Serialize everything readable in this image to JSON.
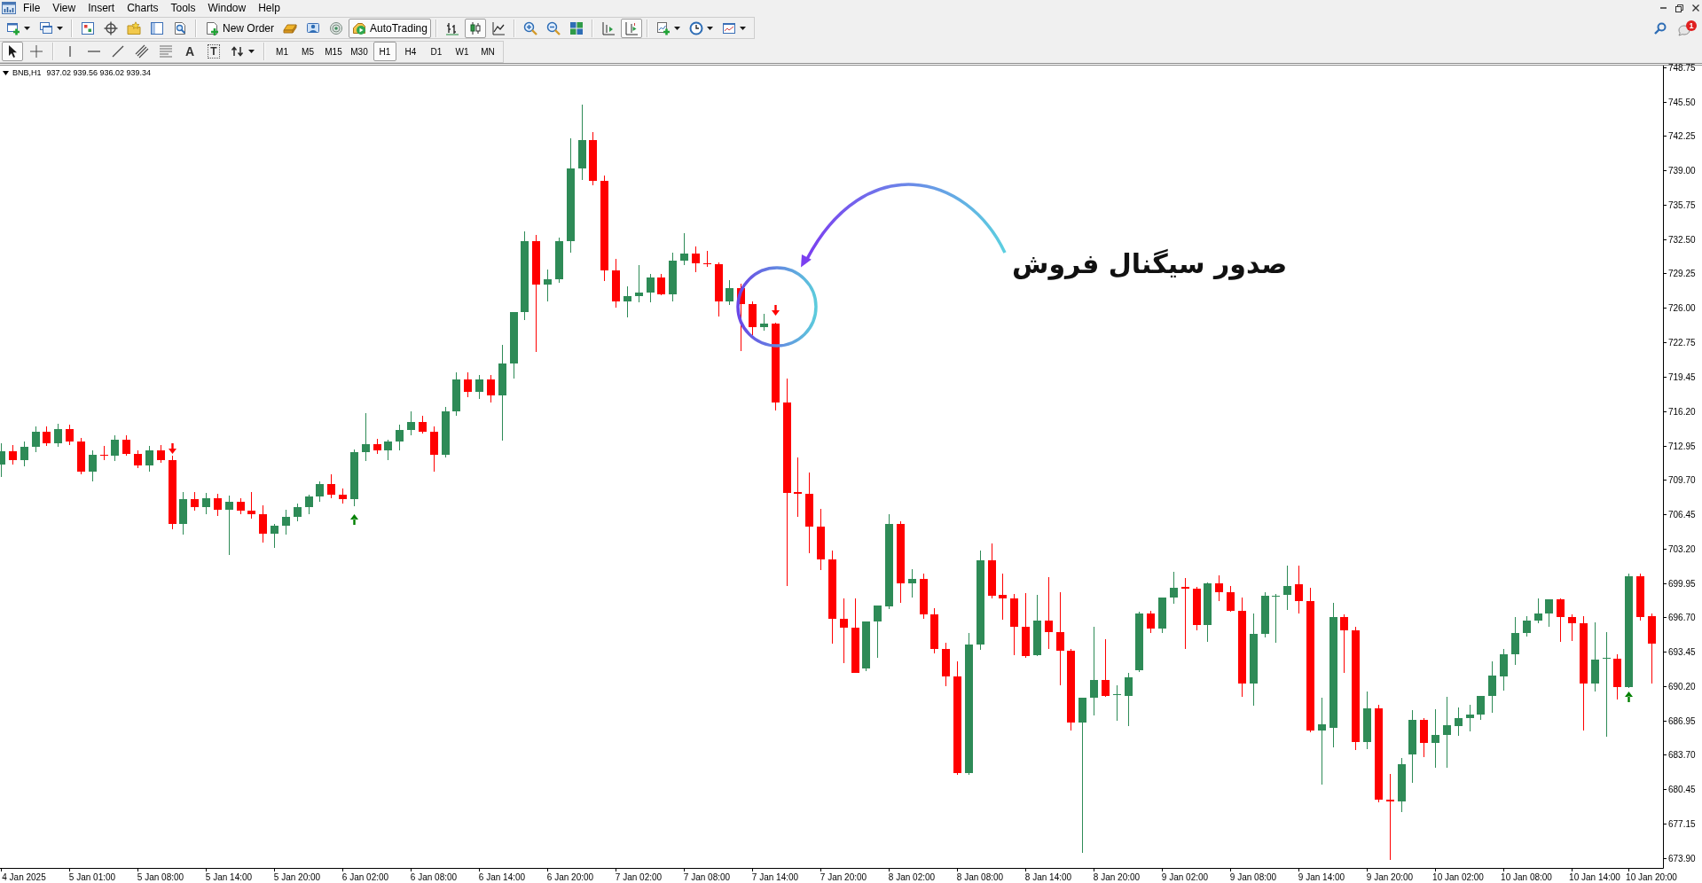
{
  "menu": [
    "File",
    "View",
    "Insert",
    "Charts",
    "Tools",
    "Window",
    "Help"
  ],
  "toolbar": [
    [
      {
        "kind": "icon_menu",
        "pressed": false
      },
      {
        "kind": "icon_menu",
        "pressed": false
      }
    ],
    [
      {
        "kind": "icon",
        "pressed": false
      },
      {
        "kind": "icon",
        "pressed": false
      },
      {
        "kind": "icon",
        "pressed": false
      },
      {
        "kind": "icon",
        "pressed": false
      },
      {
        "kind": "icon",
        "pressed": false
      }
    ],
    [
      {
        "kind": "button",
        "label": "New Order",
        "pressed": false
      },
      {
        "kind": "icon",
        "pressed": false
      },
      {
        "kind": "icon",
        "pressed": false
      },
      {
        "kind": "icon",
        "pressed": false
      },
      {
        "kind": "button",
        "label": "AutoTrading",
        "pressed": true
      }
    ],
    [
      {
        "kind": "icon",
        "pressed": false
      },
      {
        "kind": "icon",
        "pressed": true
      },
      {
        "kind": "icon",
        "pressed": false
      }
    ],
    [
      {
        "kind": "icon",
        "pressed": false
      },
      {
        "kind": "icon",
        "pressed": false
      },
      {
        "kind": "icon",
        "pressed": false
      }
    ],
    [
      {
        "kind": "icon",
        "pressed": false
      },
      {
        "kind": "icon",
        "pressed": true
      }
    ],
    [
      {
        "kind": "icon_menu",
        "pressed": false
      },
      {
        "kind": "icon_menu",
        "pressed": false
      },
      {
        "kind": "icon_menu",
        "pressed": false
      }
    ]
  ],
  "notifications": {
    "count": "1"
  },
  "drawing_toolbar": [
    [
      {
        "kind": "icon",
        "pressed": true
      },
      {
        "kind": "icon",
        "pressed": false
      }
    ],
    [
      {
        "kind": "icon",
        "pressed": false
      },
      {
        "kind": "icon",
        "pressed": false
      },
      {
        "kind": "icon",
        "pressed": false
      },
      {
        "kind": "icon",
        "pressed": false
      },
      {
        "kind": "icon",
        "pressed": false
      },
      {
        "kind": "glyph",
        "text": "A",
        "pressed": false
      },
      {
        "kind": "boxed_glyph",
        "text": "T",
        "pressed": false
      },
      {
        "kind": "icon_menu",
        "pressed": false
      }
    ]
  ],
  "timeframes": [
    {
      "label": "M1",
      "selected": false
    },
    {
      "label": "M5",
      "selected": false
    },
    {
      "label": "M15",
      "selected": false
    },
    {
      "label": "M30",
      "selected": false
    },
    {
      "label": "H1",
      "selected": true
    },
    {
      "label": "H4",
      "selected": false
    },
    {
      "label": "D1",
      "selected": false
    },
    {
      "label": "W1",
      "selected": false
    },
    {
      "label": "MN",
      "selected": false
    }
  ],
  "chart": {
    "symbol": "BNB,H1",
    "quote": "937.02 939.56 936.02 939.34",
    "chart_data": [
      {
        "type": "candlestick",
        "ylim": [
          672.98,
          748.92
        ],
        "yticks": [
          748.75,
          {
            "value": 745.5,
            "label": "745.50"
          },
          742.25,
          {
            "value": 739,
            "label": "739.00"
          },
          735.75,
          {
            "value": 732.5,
            "label": "732.50"
          },
          729.25,
          {
            "value": 726,
            "label": "726.00"
          },
          722.75,
          719.45,
          {
            "value": 716.2,
            "label": "716.20"
          },
          712.95,
          {
            "value": 709.7,
            "label": "709.70"
          },
          706.45,
          {
            "value": 703.2,
            "label": "703.20"
          },
          699.95,
          {
            "value": 696.7,
            "label": "696.70"
          },
          693.45,
          {
            "value": 690.2,
            "label": "690.20"
          },
          686.95,
          {
            "value": 683.7,
            "label": "683.70"
          },
          680.45,
          677.15,
          {
            "value": 673.9,
            "label": "673.90"
          }
        ],
        "categories": [
          null,
          null,
          "4 Jan 2025",
          null,
          null,
          null,
          null,
          null,
          "5 Jan 01:00",
          null,
          null,
          null,
          null,
          null,
          "5 Jan 08:00",
          null,
          null,
          null,
          null,
          null,
          "5 Jan 14:00",
          null,
          null,
          null,
          null,
          null,
          "5 Jan 20:00",
          null,
          null,
          null,
          null,
          null,
          "6 Jan 02:00",
          null,
          null,
          null,
          null,
          null,
          "6 Jan 08:00",
          null,
          null,
          null,
          null,
          null,
          "6 Jan 14:00",
          null,
          null,
          null,
          null,
          null,
          "6 Jan 20:00",
          null,
          null,
          null,
          null,
          null,
          "7 Jan 02:00",
          null,
          null,
          null,
          null,
          null,
          "7 Jan 08:00",
          null,
          null,
          null,
          null,
          null,
          "7 Jan 14:00",
          null,
          null,
          null,
          null,
          null,
          "7 Jan 20:00",
          null,
          null,
          null,
          null,
          null,
          "8 Jan 02:00",
          null,
          null,
          null,
          null,
          null,
          "8 Jan 08:00",
          null,
          null,
          null,
          null,
          null,
          "8 Jan 14:00",
          null,
          null,
          null,
          null,
          null,
          "8 Jan 20:00",
          null,
          null,
          null,
          null,
          null,
          "9 Jan 02:00",
          null,
          null,
          null,
          null,
          null,
          "9 Jan 08:00",
          null,
          null,
          null,
          null,
          null,
          "9 Jan 14:00",
          null,
          null,
          null,
          null,
          null,
          "9 Jan 20:00",
          null,
          null,
          null,
          null,
          null,
          "10 Jan 02:00",
          null,
          null,
          null,
          null,
          null,
          "10 Jan 08:00",
          null,
          null,
          null,
          null,
          null,
          "10 Jan 14:00",
          null,
          null,
          null,
          null,
          "10 Jan 20:00"
        ],
        "ohlc": [
          [
            711.2,
            713.2,
            710.0,
            712.4
          ],
          [
            712.4,
            713.0,
            711.2,
            711.6
          ],
          [
            711.6,
            713.3,
            711.0,
            712.8
          ],
          [
            712.8,
            714.8,
            712.3,
            714.3
          ],
          [
            714.3,
            714.8,
            712.9,
            713.2
          ],
          [
            713.2,
            715.0,
            712.8,
            714.5
          ],
          [
            714.5,
            714.9,
            713.0,
            713.3
          ],
          [
            713.3,
            713.7,
            710.2,
            710.5
          ],
          [
            710.5,
            712.5,
            709.6,
            712.1
          ],
          [
            712.1,
            712.9,
            711.6,
            712.0
          ],
          [
            712.0,
            713.9,
            711.5,
            713.5
          ],
          [
            713.5,
            713.9,
            712.0,
            712.2
          ],
          [
            712.2,
            712.5,
            710.8,
            711.1
          ],
          [
            711.1,
            712.9,
            710.5,
            712.5
          ],
          [
            712.5,
            713.0,
            711.3,
            711.6
          ],
          [
            711.6,
            712.0,
            705.0,
            705.5
          ],
          [
            705.5,
            708.6,
            704.5,
            707.9
          ],
          [
            707.9,
            708.6,
            706.8,
            707.1
          ],
          [
            707.1,
            708.5,
            706.5,
            708.0
          ],
          [
            708.0,
            708.4,
            706.3,
            706.9
          ],
          [
            706.9,
            708.2,
            702.6,
            707.6
          ],
          [
            707.6,
            708.0,
            706.5,
            706.8
          ],
          [
            706.8,
            708.6,
            706.0,
            706.5
          ],
          [
            706.5,
            707.3,
            703.8,
            704.6
          ],
          [
            704.6,
            705.5,
            703.3,
            705.4
          ],
          [
            705.4,
            706.9,
            704.5,
            706.2
          ],
          [
            706.2,
            707.5,
            705.8,
            707.1
          ],
          [
            707.1,
            708.3,
            706.5,
            708.1
          ],
          [
            708.1,
            709.6,
            707.6,
            709.3
          ],
          [
            709.3,
            710.2,
            708.0,
            708.3
          ],
          [
            708.3,
            708.9,
            707.5,
            707.9
          ],
          [
            707.9,
            712.6,
            707.2,
            712.3
          ],
          [
            712.3,
            716.0,
            711.5,
            713.1
          ],
          [
            713.1,
            713.6,
            712.2,
            712.5
          ],
          [
            712.5,
            713.5,
            711.6,
            713.3
          ],
          [
            713.3,
            714.9,
            712.5,
            714.4
          ],
          [
            714.4,
            716.2,
            713.9,
            715.2
          ],
          [
            715.2,
            715.8,
            714.1,
            714.3
          ],
          [
            714.3,
            714.8,
            710.5,
            712.1
          ],
          [
            712.1,
            716.6,
            711.8,
            716.2
          ],
          [
            716.2,
            719.9,
            715.8,
            719.2
          ],
          [
            719.2,
            719.9,
            717.5,
            718.0
          ],
          [
            718.0,
            719.6,
            717.4,
            719.2
          ],
          [
            719.2,
            719.6,
            717.0,
            717.7
          ],
          [
            717.7,
            722.5,
            713.4,
            720.7
          ],
          [
            720.7,
            725.6,
            719.3,
            725.6
          ],
          [
            725.6,
            733.2,
            724.8,
            732.3
          ],
          [
            732.3,
            732.9,
            721.8,
            728.2
          ],
          [
            728.2,
            729.6,
            726.6,
            728.7
          ],
          [
            728.7,
            732.6,
            728.4,
            732.3
          ],
          [
            732.3,
            742.0,
            731.2,
            739.2
          ],
          [
            739.2,
            745.2,
            738.1,
            741.9
          ],
          [
            741.9,
            742.6,
            737.6,
            738.0
          ],
          [
            738.0,
            738.5,
            728.5,
            729.5
          ],
          [
            729.5,
            730.6,
            726.0,
            726.6
          ],
          [
            726.6,
            728.0,
            725.1,
            727.1
          ],
          [
            727.1,
            730.0,
            726.5,
            727.4
          ],
          [
            727.4,
            729.2,
            726.5,
            728.9
          ],
          [
            728.9,
            729.2,
            727.2,
            727.3
          ],
          [
            727.3,
            731.2,
            726.6,
            730.45
          ],
          [
            730.45,
            733.1,
            730.0,
            731.1
          ],
          [
            731.1,
            731.8,
            729.4,
            730.2
          ],
          [
            730.2,
            731.4,
            729.9,
            730.1
          ],
          [
            730.1,
            730.3,
            725.2,
            726.6
          ],
          [
            726.6,
            728.6,
            726.3,
            727.9
          ],
          [
            727.9,
            728.3,
            721.9,
            726.35
          ],
          [
            726.35,
            726.6,
            723.4,
            724.2
          ],
          [
            724.2,
            725.4,
            723.8,
            724.5
          ],
          [
            724.5,
            724.6,
            716.3,
            717.0
          ],
          [
            717.0,
            719.3,
            699.7,
            708.5
          ],
          [
            708.6,
            711.8,
            706.2,
            708.4
          ],
          [
            708.4,
            710.4,
            702.8,
            705.3
          ],
          [
            705.3,
            707.0,
            701.2,
            702.2
          ],
          [
            702.2,
            703.0,
            694.2,
            696.6
          ],
          [
            696.6,
            698.5,
            692.4,
            695.75
          ],
          [
            695.75,
            698.5,
            691.4,
            691.4
          ],
          [
            691.9,
            696.3,
            691.6,
            696.3
          ],
          [
            696.3,
            697.8,
            692.9,
            697.8
          ],
          [
            697.7,
            706.5,
            697.5,
            705.5
          ],
          [
            705.5,
            705.8,
            698.1,
            699.9
          ],
          [
            699.9,
            701.3,
            698.6,
            700.3
          ],
          [
            700.3,
            700.8,
            696.6,
            697.0
          ],
          [
            697.0,
            697.6,
            693.3,
            693.7
          ],
          [
            693.7,
            694.3,
            690.2,
            691.07
          ],
          [
            691.07,
            692.5,
            681.8,
            682.0
          ],
          [
            682.0,
            695.2,
            681.8,
            694.1
          ],
          [
            694.1,
            703.0,
            693.6,
            702.1
          ],
          [
            702.1,
            703.7,
            698.5,
            698.7
          ],
          [
            698.8,
            700.8,
            696.5,
            698.5
          ],
          [
            698.5,
            698.9,
            693.1,
            695.8
          ],
          [
            695.8,
            699.0,
            692.9,
            693.0
          ],
          [
            693.1,
            698.8,
            693.0,
            696.4
          ],
          [
            696.4,
            700.5,
            693.7,
            695.3
          ],
          [
            695.3,
            699.1,
            690.3,
            693.5
          ],
          [
            693.5,
            693.7,
            686.0,
            686.7
          ],
          [
            686.7,
            689.1,
            674.4,
            689.1
          ],
          [
            689.1,
            695.8,
            687.4,
            690.8
          ],
          [
            690.8,
            694.6,
            689.2,
            689.3
          ],
          [
            689.4,
            690.3,
            686.9,
            689.4
          ],
          [
            689.3,
            691.4,
            686.4,
            691.0
          ],
          [
            691.7,
            697.2,
            691.5,
            697.1
          ],
          [
            697.1,
            697.3,
            695.2,
            695.6
          ],
          [
            695.6,
            698.6,
            695.2,
            698.6
          ],
          [
            698.6,
            701.0,
            698.0,
            699.5
          ],
          [
            699.6,
            700.4,
            693.7,
            699.4
          ],
          [
            699.4,
            699.6,
            695.5,
            696.0
          ],
          [
            696.0,
            700.0,
            694.4,
            699.9
          ],
          [
            699.9,
            700.7,
            698.2,
            699.1
          ],
          [
            699.1,
            699.7,
            697.2,
            697.3
          ],
          [
            697.3,
            698.6,
            689.2,
            690.4
          ],
          [
            690.4,
            697.1,
            688.3,
            695.1
          ],
          [
            695.1,
            699.1,
            694.8,
            698.7
          ],
          [
            698.7,
            698.9,
            694.3,
            698.7
          ],
          [
            698.8,
            701.6,
            697.4,
            699.7
          ],
          [
            699.8,
            701.6,
            697.1,
            698.2
          ],
          [
            698.2,
            699.5,
            685.8,
            686.0
          ],
          [
            686.0,
            689.1,
            680.9,
            686.6
          ],
          [
            686.2,
            698.1,
            684.4,
            696.7
          ],
          [
            696.7,
            697.0,
            691.4,
            695.5
          ],
          [
            695.5,
            695.8,
            684.1,
            684.9
          ],
          [
            684.9,
            689.7,
            684.2,
            688.1
          ],
          [
            688.1,
            688.4,
            679.2,
            679.4
          ],
          [
            679.4,
            681.9,
            673.7,
            679.3
          ],
          [
            679.3,
            683.4,
            678.3,
            682.8
          ],
          [
            683.7,
            687.9,
            681.0,
            687.0
          ],
          [
            687.0,
            687.2,
            683.5,
            684.8
          ],
          [
            684.8,
            688.0,
            682.5,
            685.6
          ],
          [
            685.6,
            689.2,
            682.5,
            686.5
          ],
          [
            686.4,
            688.2,
            685.5,
            687.2
          ],
          [
            687.2,
            688.4,
            685.9,
            687.5
          ],
          [
            687.5,
            689.3,
            687.0,
            689.3
          ],
          [
            689.3,
            692.5,
            687.7,
            691.2
          ],
          [
            691.1,
            693.7,
            689.8,
            693.2
          ],
          [
            693.2,
            696.7,
            692.2,
            695.2
          ],
          [
            695.2,
            696.8,
            694.9,
            696.4
          ],
          [
            696.4,
            698.5,
            696.1,
            697.1
          ],
          [
            697.1,
            698.4,
            695.8,
            698.4
          ],
          [
            698.4,
            698.5,
            694.4,
            696.7
          ],
          [
            696.7,
            697.0,
            694.5,
            696.1
          ],
          [
            696.1,
            696.8,
            686.0,
            690.4
          ],
          [
            690.4,
            696.2,
            689.7,
            692.7
          ],
          [
            692.8,
            695.3,
            685.4,
            692.9
          ],
          [
            692.8,
            693.2,
            688.9,
            690.1
          ],
          [
            690.1,
            700.8,
            690.0,
            700.6
          ],
          [
            700.6,
            700.8,
            696.4,
            696.7
          ],
          [
            696.8,
            697.1,
            690.4,
            694.2
          ]
        ],
        "series": [
          {
            "type": "scatter",
            "marker": "triangle",
            "color": "#ff0000",
            "values": [
              null,
              null,
              null,
              null,
              null,
              null,
              null,
              null,
              null,
              null,
              null,
              null,
              null,
              null,
              null,
              712.6,
              null,
              null,
              null,
              null,
              null,
              null,
              null,
              null,
              null,
              null,
              null,
              null,
              null,
              null,
              null,
              null,
              null,
              null,
              null,
              null,
              null,
              null,
              null,
              null,
              null,
              null,
              null,
              null,
              null,
              null,
              null,
              null,
              null,
              null,
              null,
              null,
              null,
              null,
              null,
              null,
              null,
              null,
              null,
              null,
              null,
              null,
              null,
              null,
              null,
              null,
              null,
              null,
              725.7,
              null,
              null,
              null,
              null,
              null,
              null,
              null,
              null,
              null,
              null,
              null,
              null,
              null,
              null,
              null,
              null,
              null,
              null,
              null,
              null,
              null,
              null,
              null,
              null,
              null,
              null,
              null,
              null,
              null,
              null,
              null,
              null,
              null,
              null,
              null,
              null,
              null,
              null,
              null,
              null,
              null,
              null,
              null,
              null,
              null,
              null,
              null,
              null,
              null,
              null,
              null,
              null,
              null,
              null,
              null,
              null,
              null,
              null,
              null,
              null,
              null,
              null,
              null,
              null,
              null,
              null,
              null,
              null,
              null,
              null,
              null,
              null,
              null,
              null,
              null,
              null,
              null
            ]
          },
          {
            "type": "scatter",
            "marker": "triangle",
            "color": "#008000",
            "values": [
              null,
              null,
              null,
              null,
              null,
              null,
              null,
              null,
              null,
              null,
              null,
              null,
              null,
              null,
              null,
              null,
              null,
              null,
              null,
              null,
              null,
              null,
              null,
              null,
              null,
              null,
              null,
              null,
              null,
              null,
              null,
              706.0,
              null,
              null,
              null,
              null,
              null,
              null,
              null,
              null,
              null,
              null,
              null,
              null,
              null,
              null,
              null,
              null,
              null,
              null,
              null,
              null,
              null,
              null,
              null,
              null,
              null,
              null,
              null,
              null,
              null,
              null,
              null,
              null,
              null,
              null,
              null,
              null,
              null,
              null,
              null,
              null,
              null,
              null,
              null,
              null,
              null,
              null,
              null,
              null,
              null,
              null,
              null,
              null,
              null,
              null,
              null,
              null,
              null,
              null,
              null,
              null,
              null,
              null,
              null,
              null,
              null,
              null,
              null,
              null,
              null,
              null,
              null,
              null,
              null,
              null,
              null,
              null,
              null,
              null,
              null,
              null,
              null,
              null,
              null,
              null,
              null,
              null,
              null,
              null,
              null,
              null,
              null,
              null,
              null,
              null,
              null,
              null,
              null,
              null,
              null,
              null,
              null,
              null,
              null,
              null,
              null,
              null,
              null,
              null,
              null,
              null,
              null,
              689.3,
              null,
              null
            ]
          }
        ],
        "annotations": [
          "صدور سیگنال فروش"
        ]
      }
    ]
  }
}
